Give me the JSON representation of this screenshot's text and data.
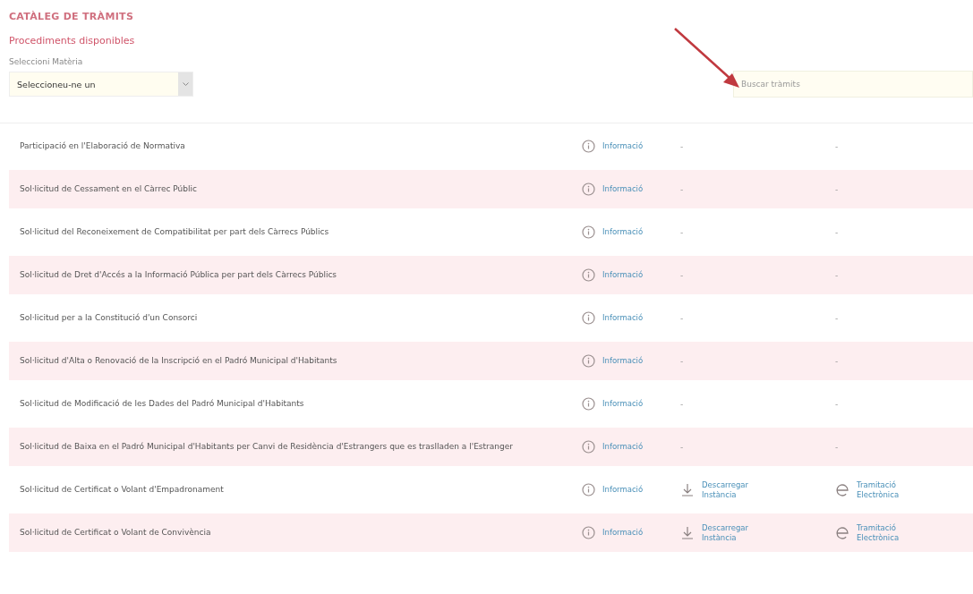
{
  "title": "CATÀLEG DE TRÀMITS",
  "subtitle": "Procediments disponibles",
  "subject_filter": {
    "label": "Seleccioni Matèria",
    "value": "Seleccioneu-ne un"
  },
  "search": {
    "placeholder": "Buscar tràmits"
  },
  "rows": [
    {
      "name": "Participació en l'Elaboració de Normativa",
      "info": "Informació",
      "download": {
        "kind": "dash",
        "text": "-"
      },
      "processing": {
        "kind": "dash",
        "text": "-"
      }
    },
    {
      "name": "Sol·licitud de Cessament en el Càrrec Públic",
      "info": "Informació",
      "download": {
        "kind": "dash",
        "text": "-"
      },
      "processing": {
        "kind": "dash",
        "text": "-"
      }
    },
    {
      "name": "Sol·licitud del Reconeixement de Compatibilitat per part dels Càrrecs Públics",
      "info": "Informació",
      "download": {
        "kind": "dash",
        "text": "-"
      },
      "processing": {
        "kind": "dash",
        "text": "-"
      }
    },
    {
      "name": "Sol·licitud de Dret d'Accés a la Informació Pública per part dels Càrrecs Públics",
      "info": "Informació",
      "download": {
        "kind": "dash",
        "text": "-"
      },
      "processing": {
        "kind": "dash",
        "text": "-"
      }
    },
    {
      "name": "Sol·licitud per a la Constitució d'un Consorci",
      "info": "Informació",
      "download": {
        "kind": "dash",
        "text": "-"
      },
      "processing": {
        "kind": "dash",
        "text": "-"
      }
    },
    {
      "name": "Sol·licitud d'Alta o Renovació de la Inscripció en el Padró Municipal d'Habitants",
      "info": "Informació",
      "download": {
        "kind": "dash",
        "text": "-"
      },
      "processing": {
        "kind": "dash",
        "text": "-"
      }
    },
    {
      "name": "Sol·licitud de Modificació de les Dades del Padró Municipal d'Habitants",
      "info": "Informació",
      "download": {
        "kind": "dash",
        "text": "-"
      },
      "processing": {
        "kind": "dash",
        "text": "-"
      }
    },
    {
      "name": "Sol·licitud de Baixa en el Padró Municipal d'Habitants per Canvi de Residència d'Estrangers que es traslladen a l'Estranger",
      "info": "Informació",
      "download": {
        "kind": "dash",
        "text": "-"
      },
      "processing": {
        "kind": "dash",
        "text": "-"
      }
    },
    {
      "name": "Sol·licitud de Certificat o Volant d'Empadronament",
      "info": "Informació",
      "download": {
        "kind": "link",
        "text": "Descarregar Instància"
      },
      "processing": {
        "kind": "link",
        "text": "Tramitació Electrònica"
      }
    },
    {
      "name": "Sol·licitud de Certificat o Volant de Convivència",
      "info": "Informació",
      "download": {
        "kind": "link",
        "text": "Descarregar Instància"
      },
      "processing": {
        "kind": "link",
        "text": "Tramitació Electrònica"
      }
    }
  ]
}
